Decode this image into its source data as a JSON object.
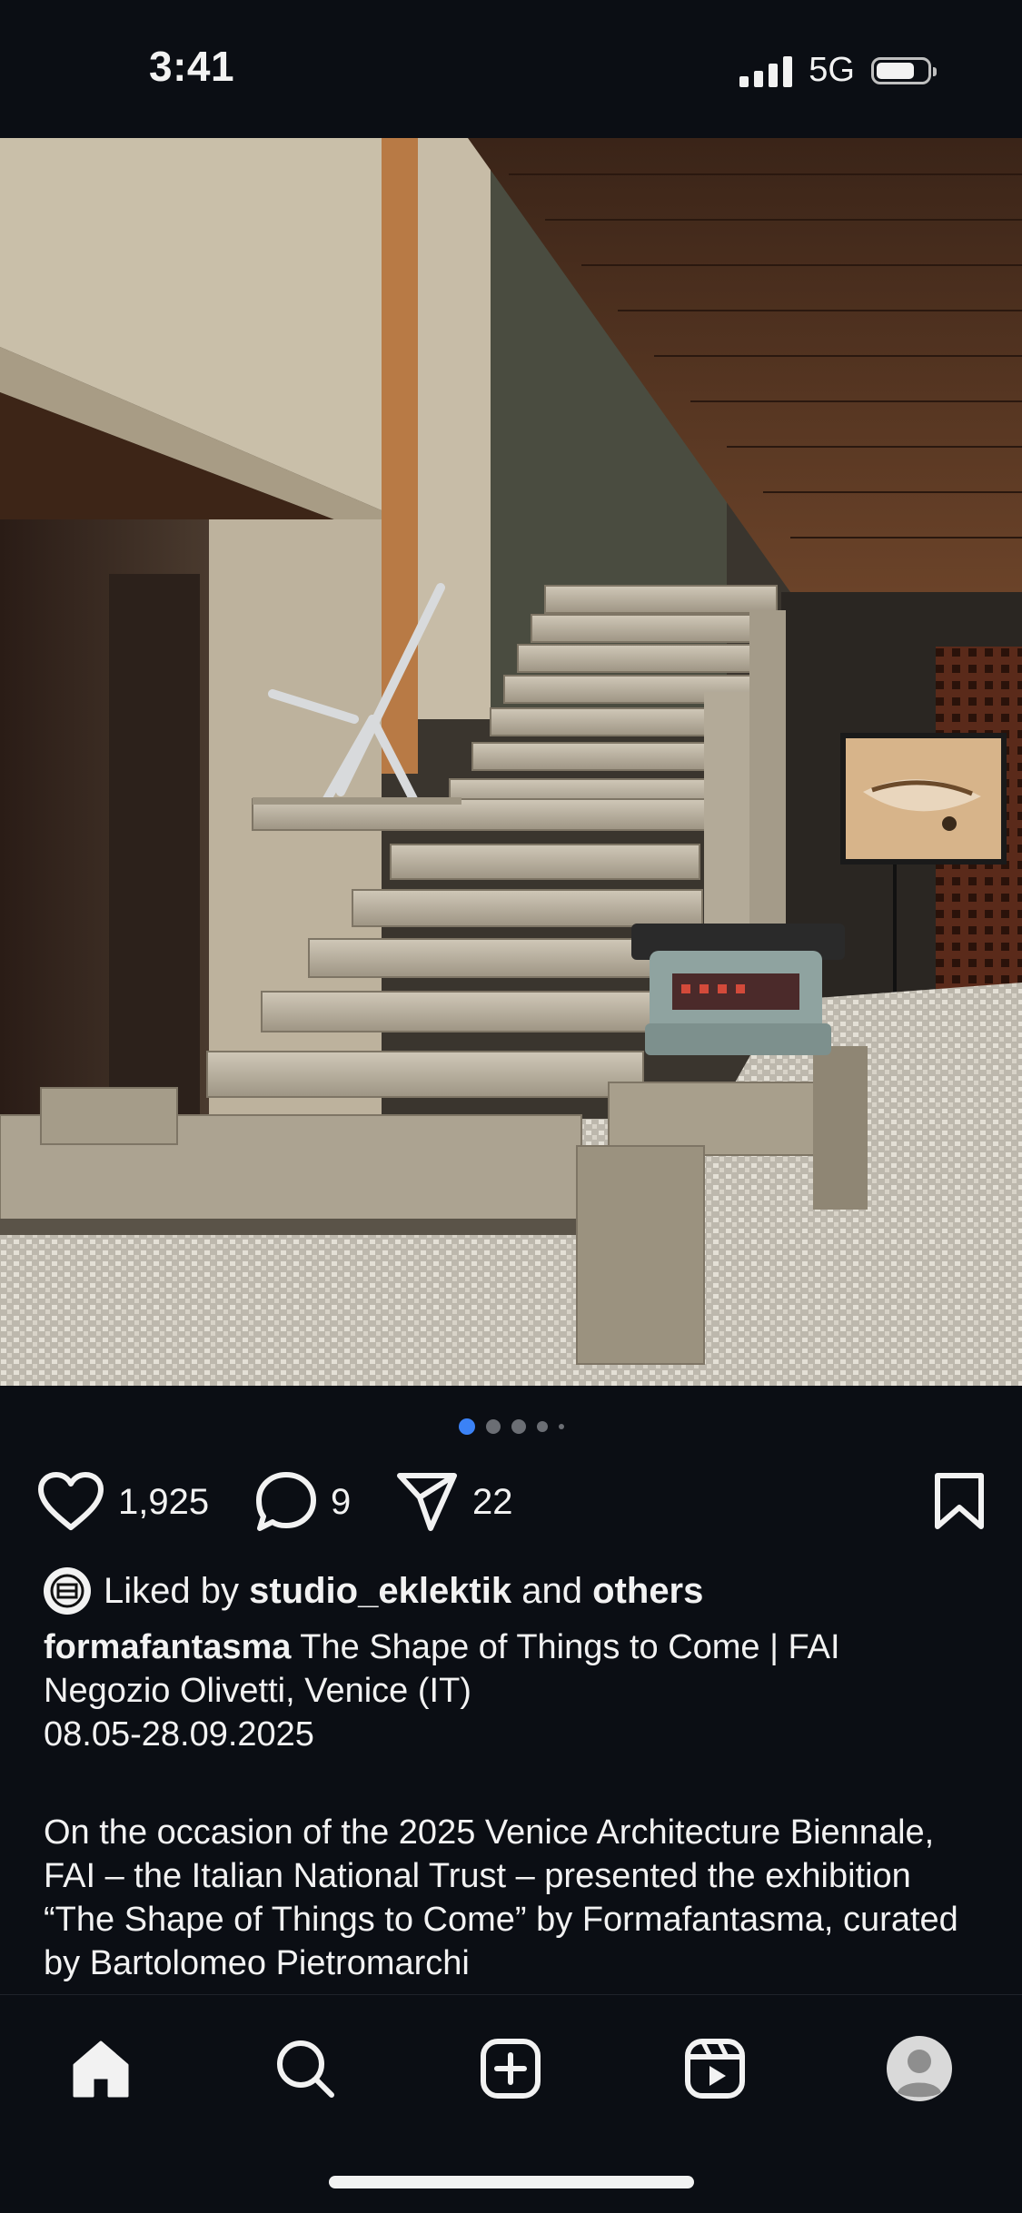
{
  "status_bar": {
    "time": "3:41",
    "network": "5G",
    "signal_bars": 4,
    "battery_level": 0.75
  },
  "post": {
    "image_alt_icon": "photo",
    "carousel": {
      "count": 5,
      "active_index": 0
    },
    "actions": {
      "likes": "1,925",
      "comments": "9",
      "shares": "22"
    },
    "liked_by": {
      "prefix": "Liked by",
      "user": "studio_eklektik",
      "connector": "and",
      "suffix": "others"
    },
    "caption": {
      "username": "formafantasma",
      "line1": " The Shape of Things to Come | FAI",
      "line2": "Negozio Olivetti, Venice (IT)",
      "line3": "08.05-28.09.2025",
      "paragraph": "On the occasion of the 2025 Venice Architecture Biennale, FAI – the Italian National Trust – presented the exhibition “The Shape of Things to Come” by Formafantasma, curated by Bartolomeo Pietromarchi"
    }
  },
  "bottom_nav": {
    "items": [
      "home-icon",
      "search-icon",
      "create-icon",
      "reels-icon",
      "profile-icon"
    ]
  },
  "colors": {
    "background": "#0b0e14",
    "text": "#f2f2f2",
    "carousel_active": "#3b82f6"
  }
}
